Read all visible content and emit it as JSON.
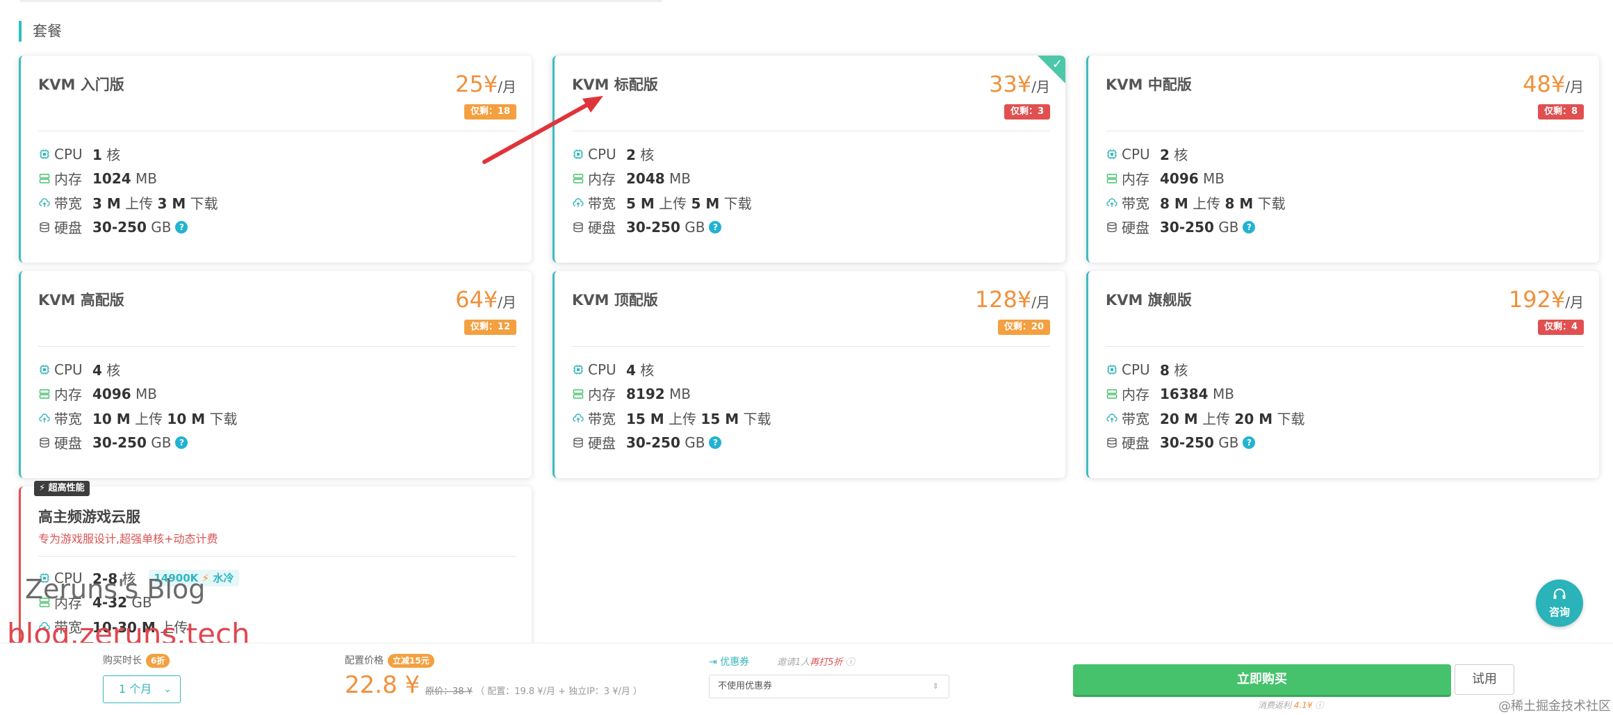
{
  "section_title": "套餐",
  "plans": [
    {
      "name": "KVM 入门版",
      "price": "25¥",
      "unit": "/月",
      "stock": "仅剩：18",
      "stock_color": "orange",
      "cpu": "1",
      "cpu_unit": "核",
      "mem": "1024",
      "mem_unit": "MB",
      "bw_up": "3 M",
      "bw_down": "3 M",
      "disk": "30-250",
      "disk_unit": "GB"
    },
    {
      "name": "KVM 标配版",
      "price": "33¥",
      "unit": "/月",
      "stock": "仅剩：3",
      "stock_color": "red",
      "cpu": "2",
      "cpu_unit": "核",
      "mem": "2048",
      "mem_unit": "MB",
      "bw_up": "5 M",
      "bw_down": "5 M",
      "disk": "30-250",
      "disk_unit": "GB",
      "selected": true
    },
    {
      "name": "KVM 中配版",
      "price": "48¥",
      "unit": "/月",
      "stock": "仅剩：8",
      "stock_color": "red",
      "cpu": "2",
      "cpu_unit": "核",
      "mem": "4096",
      "mem_unit": "MB",
      "bw_up": "8 M",
      "bw_down": "8 M",
      "disk": "30-250",
      "disk_unit": "GB"
    },
    {
      "name": "KVM 高配版",
      "price": "64¥",
      "unit": "/月",
      "stock": "仅剩：12",
      "stock_color": "orange",
      "cpu": "4",
      "cpu_unit": "核",
      "mem": "4096",
      "mem_unit": "MB",
      "bw_up": "10 M",
      "bw_down": "10 M",
      "disk": "30-250",
      "disk_unit": "GB"
    },
    {
      "name": "KVM 顶配版",
      "price": "128¥",
      "unit": "/月",
      "stock": "仅剩：20",
      "stock_color": "orange",
      "cpu": "4",
      "cpu_unit": "核",
      "mem": "8192",
      "mem_unit": "MB",
      "bw_up": "15 M",
      "bw_down": "15 M",
      "disk": "30-250",
      "disk_unit": "GB"
    },
    {
      "name": "KVM 旗舰版",
      "price": "192¥",
      "unit": "/月",
      "stock": "仅剩：4",
      "stock_color": "red",
      "cpu": "8",
      "cpu_unit": "核",
      "mem": "16384",
      "mem_unit": "MB",
      "bw_up": "20 M",
      "bw_down": "20 M",
      "disk": "30-250",
      "disk_unit": "GB"
    }
  ],
  "spec_labels": {
    "cpu": "CPU",
    "mem": "内存",
    "bw": "带宽",
    "disk": "硬盘",
    "up": "上传",
    "down": "下载",
    "help": "?"
  },
  "game_plan": {
    "badge": "超高性能",
    "name": "高主频游戏云服",
    "desc": "专为游戏服设计,超强单核+动态计费",
    "cpu": "2-8",
    "cpu_unit": "核",
    "freq_tag": "14900K",
    "cooling": "水冷",
    "mem": "4-32",
    "mem_unit": "GB",
    "bw": "10-30 M",
    "bw_up": "上传"
  },
  "watermarks": {
    "blog_name": "Zeruns's Blog",
    "blog_url": "blog.zeruns.tech"
  },
  "consult": {
    "label": "咨询"
  },
  "bottom_bar": {
    "duration_label": "购买时长",
    "duration_discount": "6折",
    "duration_value": "1 个月",
    "config_price_label": "配置价格",
    "config_price_discount": "立减15元",
    "config_price": "22.8 ¥",
    "original_price": "原价：38 ¥",
    "price_breakdown": "（ 配置：19.8 ¥/月 + 独立IP：3 ¥/月 ）",
    "coupon_label": "优惠券",
    "coupon_hint_prefix": "邀请1人",
    "coupon_hint_emph": "再打5折",
    "coupon_select": "不使用优惠券",
    "buy_label": "立即购买",
    "trial_label": "试用",
    "rebate_prefix": "消费返利",
    "rebate_value": "4.1¥",
    "community": "@稀土掘金技术社区"
  },
  "colors": {
    "accent": "#3cbcc0",
    "price": "#f0913b",
    "buy": "#46c26c",
    "danger": "#e05050",
    "annotation_arrow": "#e0343a"
  }
}
